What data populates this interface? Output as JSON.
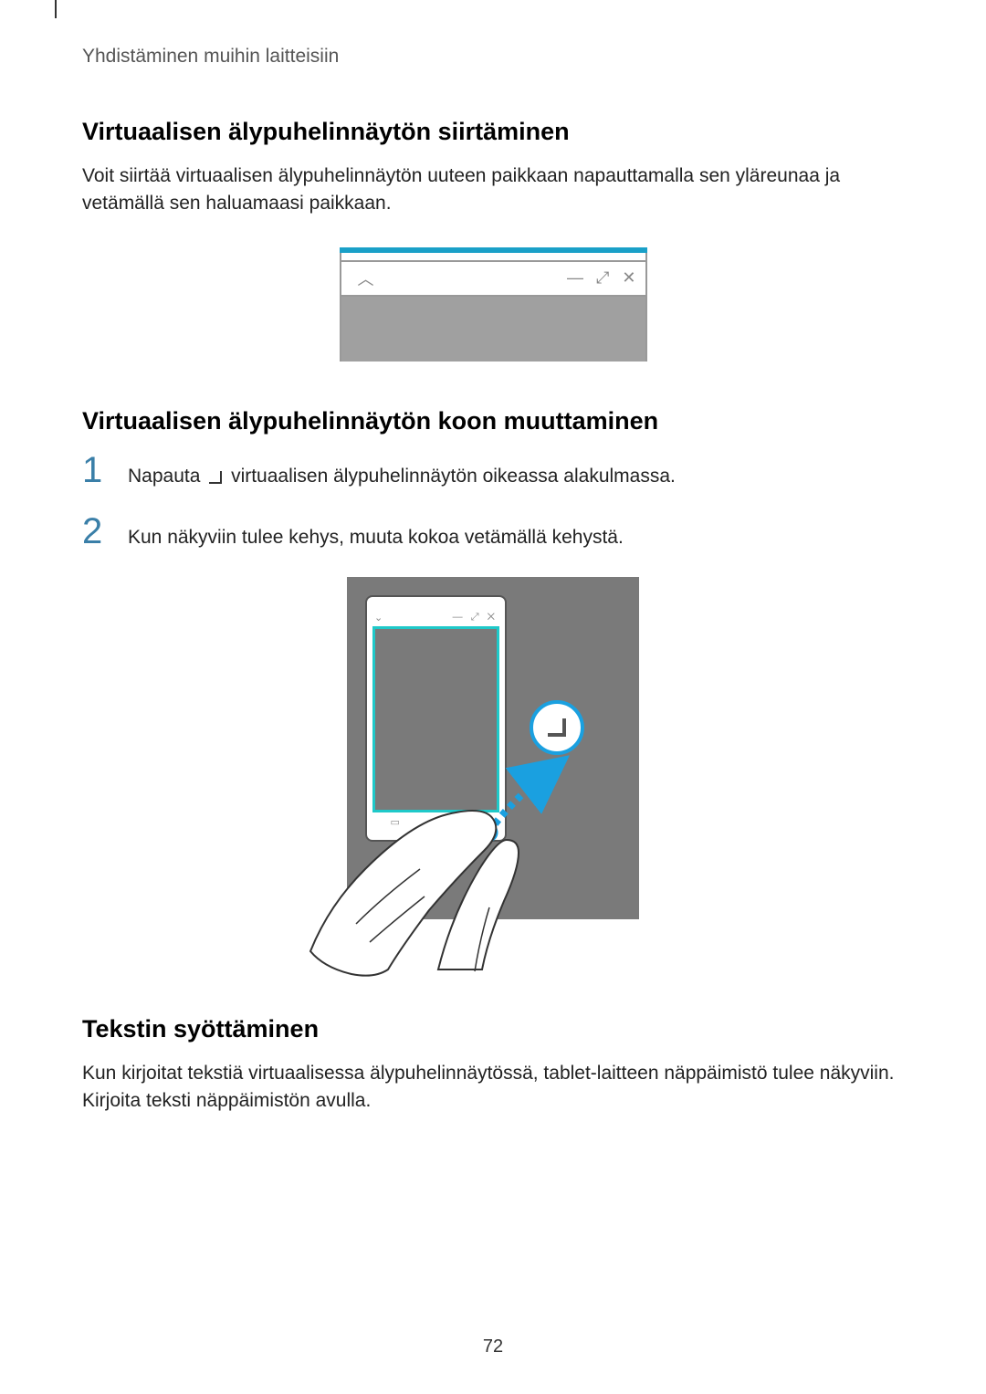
{
  "header": {
    "breadcrumb": "Yhdistäminen muihin laitteisiin"
  },
  "sections": {
    "move": {
      "heading": "Virtuaalisen älypuhelinnäytön siirtäminen",
      "body": "Voit siirtää virtuaalisen älypuhelinnäytön uuteen paikkaan napauttamalla sen yläreunaa ja vetämällä sen haluamaasi paikkaan."
    },
    "resize": {
      "heading": "Virtuaalisen älypuhelinnäytön koon muuttaminen",
      "step1_before": "Napauta ",
      "step1_after": " virtuaalisen älypuhelinnäytön oikeassa alakulmassa.",
      "step2": "Kun näkyviin tulee kehys, muuta kokoa vetämällä kehystä."
    },
    "text_input": {
      "heading": "Tekstin syöttäminen",
      "body": "Kun kirjoitat tekstiä virtuaalisessa älypuhelinnäytössä, tablet-laitteen näppäimistö tulee näkyviin. Kirjoita teksti näppäimistön avulla."
    }
  },
  "numbers": {
    "one": "1",
    "two": "2"
  },
  "footer": {
    "page": "72"
  }
}
